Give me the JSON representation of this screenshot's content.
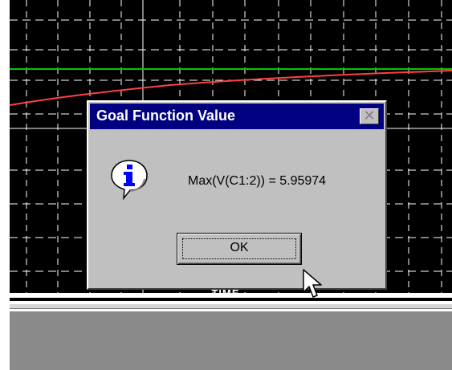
{
  "dialog": {
    "title": "Goal Function Value",
    "close_icon": "close-x-icon",
    "info_icon": "info-speech-bubble-icon",
    "message": "Max(V(C1:2)) = 5.95974",
    "ok_label": "OK"
  },
  "plot": {
    "x_axis_label": "TIME",
    "background": "#000000",
    "grid_color": "#ffffff",
    "traces": [
      {
        "color": "#00c800"
      },
      {
        "color": "#ff4040"
      }
    ]
  },
  "colors": {
    "titlebar": "#000080",
    "face": "#c0c0c0",
    "status_panel": "#8a8a8a"
  },
  "cursor": "arrow-pointer-icon"
}
